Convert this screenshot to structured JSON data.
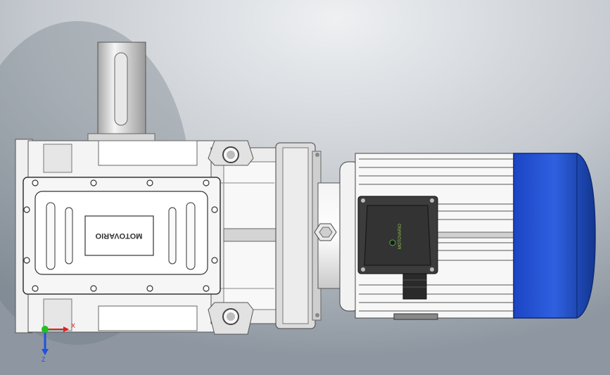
{
  "nameplate": {
    "brand": "MOTOVARIO"
  },
  "terminal_box": {
    "logo_text": "MOTOVARIO"
  },
  "triad": {
    "x_label": "X",
    "z_label": "Z"
  },
  "colors": {
    "background_light": "#e4e7ea",
    "background_dark": "#8f98a2",
    "metal_light": "#f2f2f2",
    "metal_mid": "#d9d9d9",
    "metal_dark": "#a9a9a9",
    "motor_blue": "#2a56d6",
    "motor_blue_dark": "#163a9e",
    "terminal_box": "#3a3a3a",
    "axis_x": "#e02020",
    "axis_y": "#20c020",
    "axis_z": "#2050e0"
  }
}
